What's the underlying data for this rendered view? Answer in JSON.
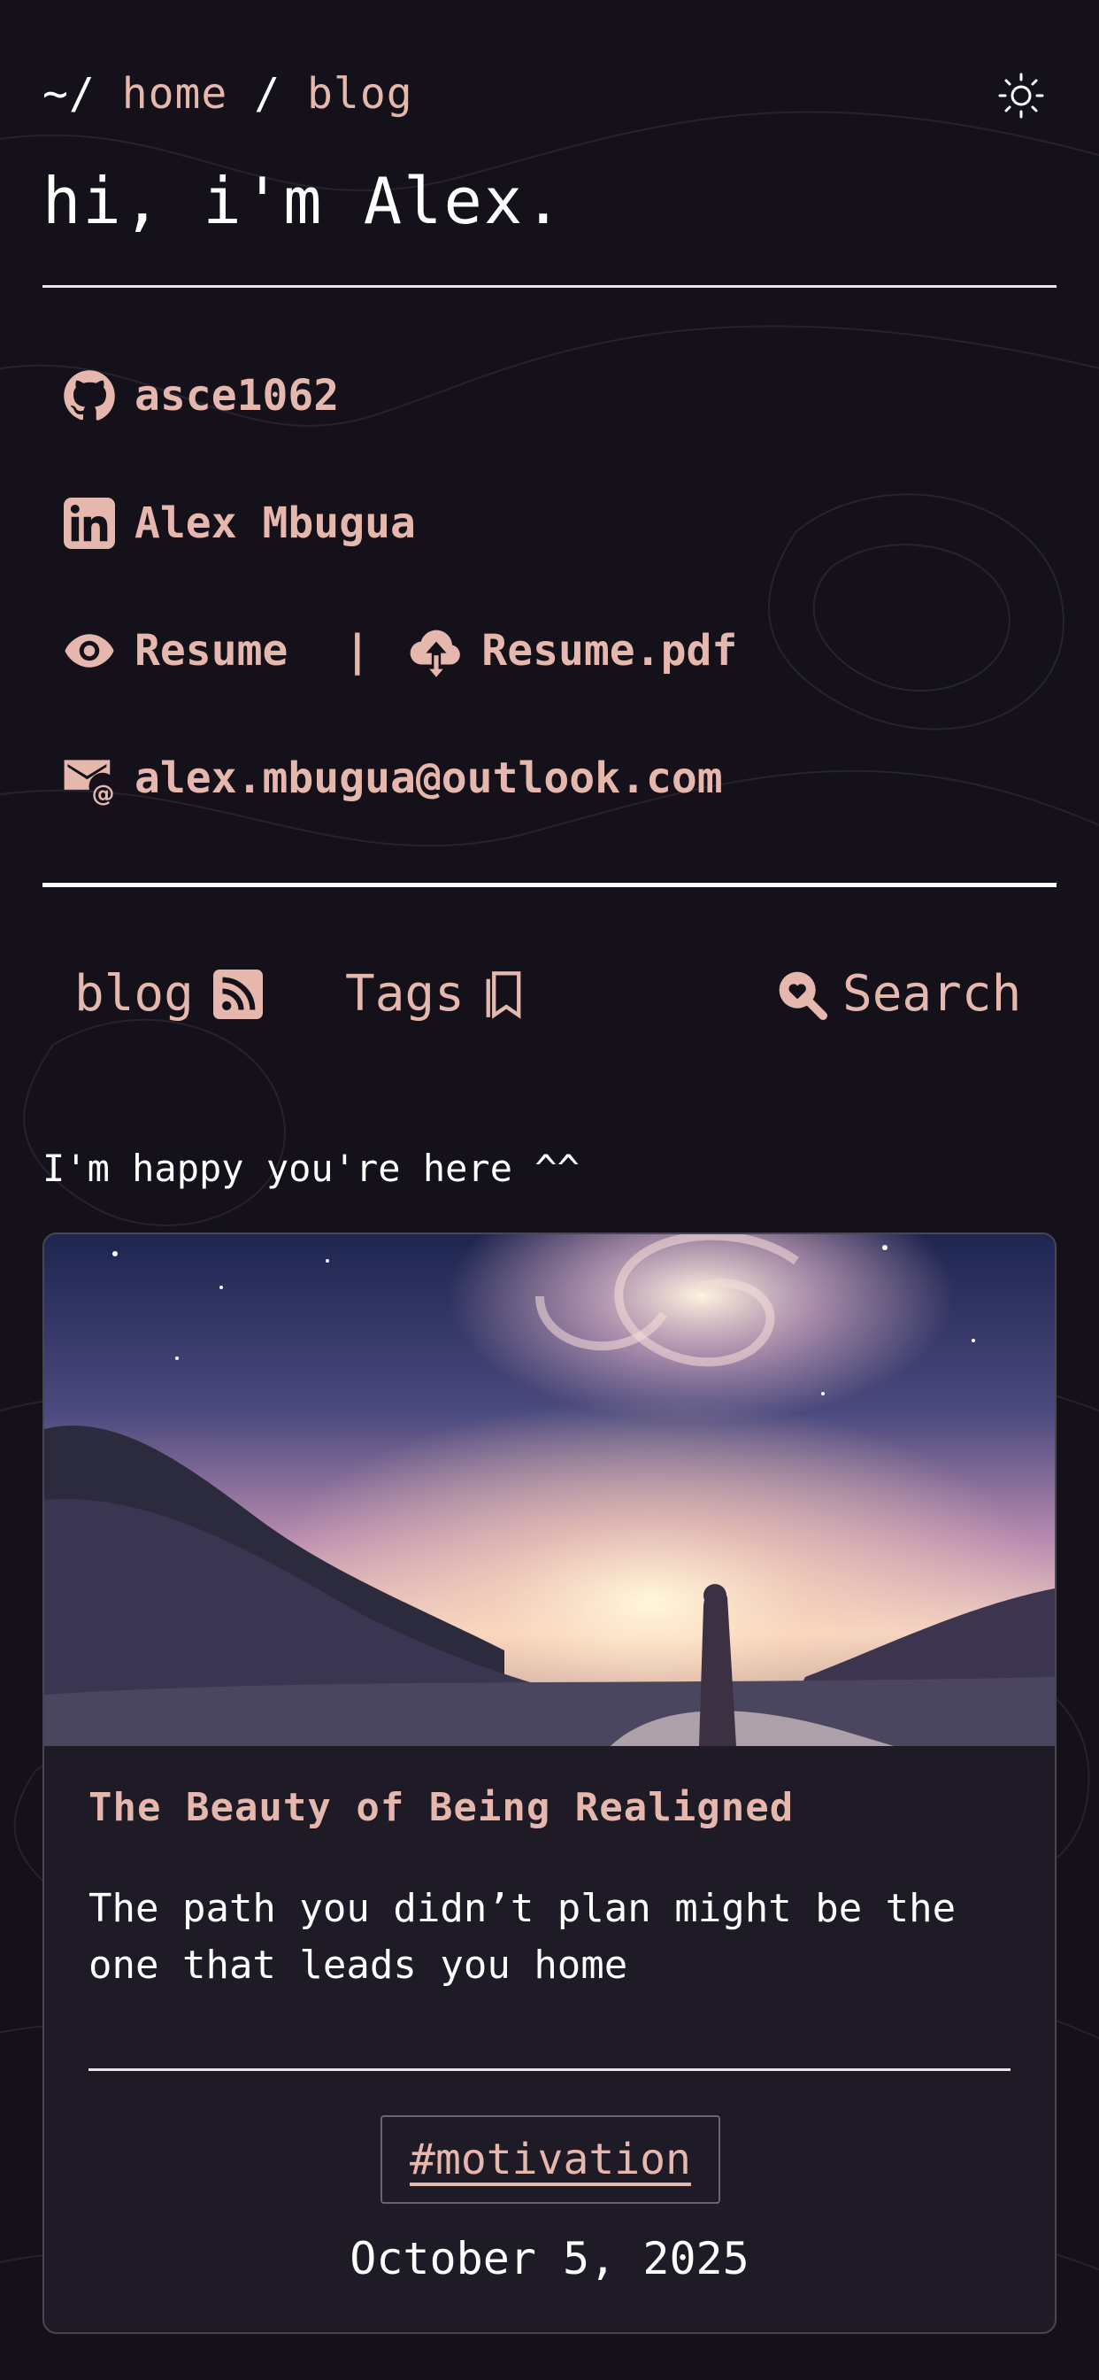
{
  "breadcrumb": {
    "root": "~/",
    "home": "home",
    "separator": "/",
    "current": "blog"
  },
  "header": {
    "title": "hi, i'm Alex."
  },
  "contacts": {
    "github": "asce1062",
    "linkedin": "Alex Mbugua",
    "resume": "Resume",
    "pipe": "|",
    "resume_pdf": "Resume.pdf",
    "email": "alex.mbugua@outlook.com"
  },
  "nav": {
    "blog": "blog",
    "tags": "Tags",
    "search": "Search"
  },
  "tagline": "I'm happy you're here ^^",
  "post": {
    "title": "The Beauty of Being Realigned",
    "description": "The path you didn’t plan might be the one that leads you home",
    "tag": "#motivation",
    "date": "October 5, 2025"
  },
  "colors": {
    "background": "#14111b",
    "accent": "#e6b8ad",
    "card": "#1f1b26",
    "text": "#ffffff"
  },
  "icons": [
    "sun-icon",
    "github-icon",
    "linkedin-icon",
    "eye-icon",
    "cloud-download-icon",
    "email-icon",
    "rss-icon",
    "bookmark-icon",
    "search-heart-icon"
  ]
}
